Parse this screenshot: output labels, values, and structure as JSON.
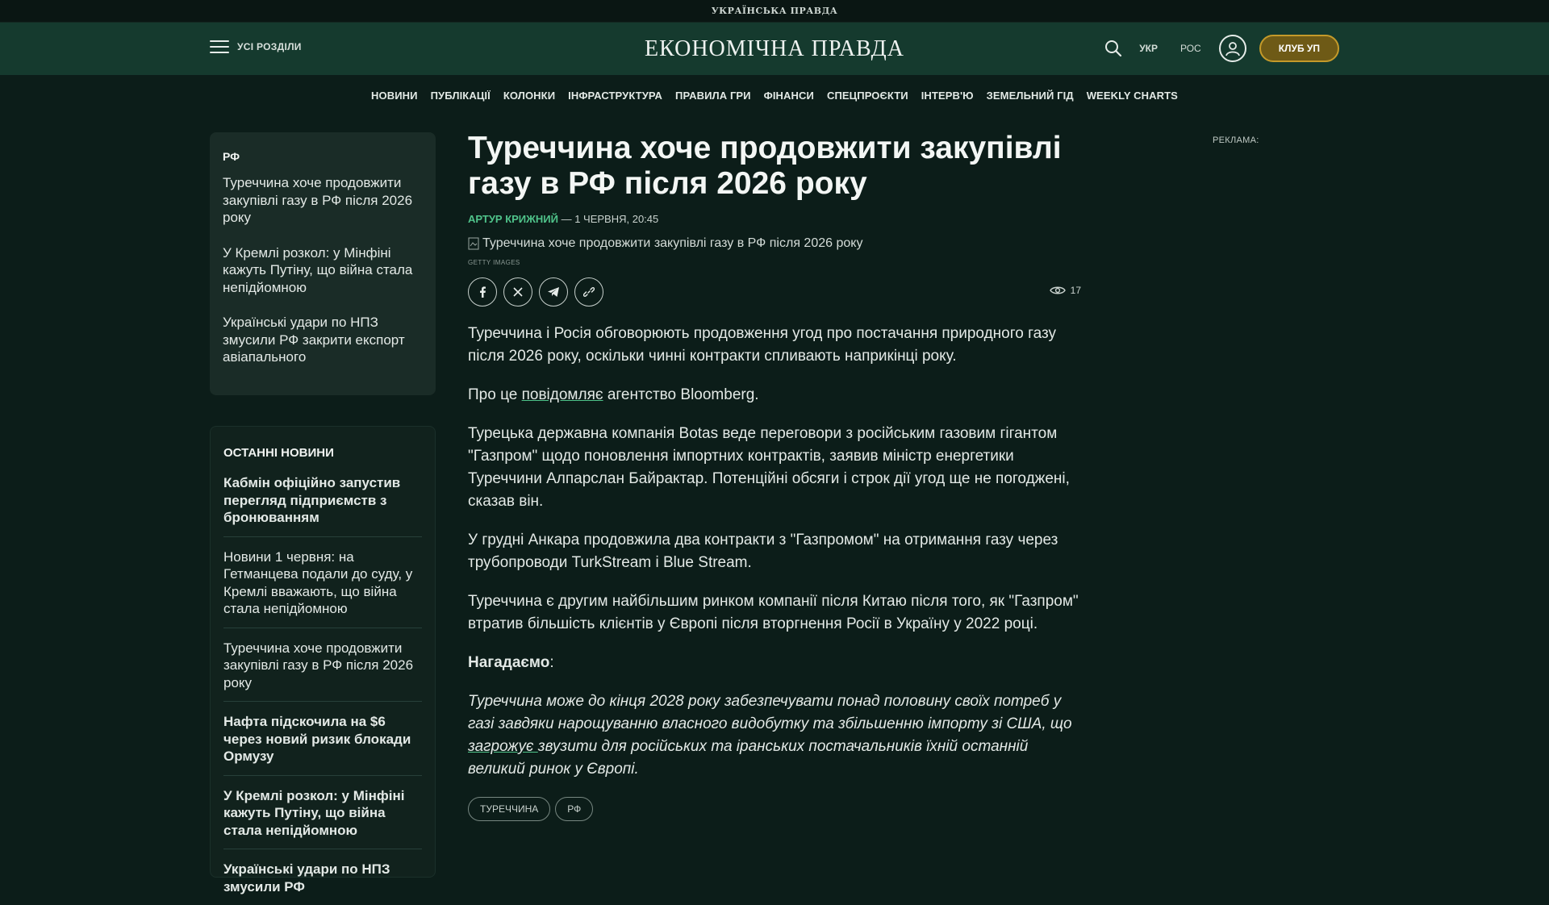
{
  "topbar": {
    "site_name": "УКРАЇНСЬКА ПРАВДА"
  },
  "header": {
    "menu_label": "УСІ РОЗДІЛИ",
    "brand": "ЕКОНОМІЧНА ПРАВДА",
    "lang_ukr": "УКР",
    "lang_ros": "РОС",
    "club_label": "КЛУБ УП"
  },
  "nav": [
    "НОВИНИ",
    "ПУБЛІКАЦІЇ",
    "КОЛОНКИ",
    "ІНФРАСТРУКТУРА",
    "ПРАВИЛА ГРИ",
    "ФІНАНСИ",
    "СПЕЦПРОЄКТИ",
    "ІНТЕРВ'Ю",
    "ЗЕМЕЛЬНИЙ ГІД",
    "WEEKLY CHARTS"
  ],
  "sidebar_related": {
    "tag": "РФ",
    "items": [
      "Туреччина хоче продовжити закупівлі газу в РФ після 2026 року",
      "У Кремлі розкол: у Мінфіні кажуть Путіну, що війна стала непідйомною",
      "Українські удари по НПЗ змусили РФ закрити експорт авіапального"
    ]
  },
  "sidebar_latest": {
    "heading": "ОСТАННІ НОВИНИ",
    "items": [
      "Кабмін офіційно запустив перегляд підприємств з бронюванням",
      "Новини 1 червня: на Гетманцева подали до суду, у Кремлі вважають, що війна стала непідйомною",
      "Туреччина хоче продовжити закупівлі газу в РФ після 2026 року",
      "Нафта підскочила на $6 через новий ризик блокади Ормузу",
      "У Кремлі розкол: у Мінфіні кажуть Путіну, що війна стала непідйомною",
      "Українські удари по НПЗ змусили РФ"
    ]
  },
  "article": {
    "title": "Туреччина хоче продовжити закупівлі газу в РФ після 2026 року",
    "author": "АРТУР КРИЖНИЙ",
    "date": " — 1 ЧЕРВНЯ, 20:45",
    "image_alt": "Туреччина хоче продовжити закупівлі газу в РФ після 2026 року",
    "image_credit": "GETTY IMAGES",
    "views": "17",
    "p1": "Туреччина і Росія обговорюють продовження угод про постачання природного газу після 2026 року, оскільки чинні контракти спливають наприкінці року.",
    "p2_before": "Про це ",
    "p2_link": "повідомляє",
    "p2_after": " агентство Bloomberg.",
    "p3": "Турецька державна компанія Botas веде переговори з російським газовим гігантом \"Газпром\" щодо поновлення імпортних контрактів, заявив міністр енергетики Туреччини Алпарслан Байрактар. Потенційні обсяги і строк дії угод ще не погоджені, сказав він.",
    "p4": "У грудні Анкара продовжила два контракти з \"Газпромом\" на отримання газу через трубопроводи TurkStream і Blue Stream.",
    "p5": "Туреччина є другим найбільшим ринком компанії після Китаю після того, як \"Газпром\" втратив більшість клієнтів у Європі після вторгнення Росії в Україну у 2022 році.",
    "reminder_label": "Нагадаємо",
    "reminder_colon": ":",
    "p6_before": "Туреччина може до кінця 2028 року забезпечувати понад половину своїх потреб у газі завдяки нарощуванню власного видобутку та збільшенню імпорту зі США, що ",
    "p6_link": "загрожує ",
    "p6_after": "звузити для російських та іранських постачальників їхній останній великий ринок у Європі.",
    "tags": [
      "ТУРЕЧЧИНА",
      "РФ"
    ]
  },
  "ad_label": "РЕКЛАМА:",
  "colors": {
    "accent_green": "#4fc38a",
    "header_bg": "#153a2e",
    "page_bg": "#0c1d19",
    "club_gold": "#c49a2a"
  }
}
